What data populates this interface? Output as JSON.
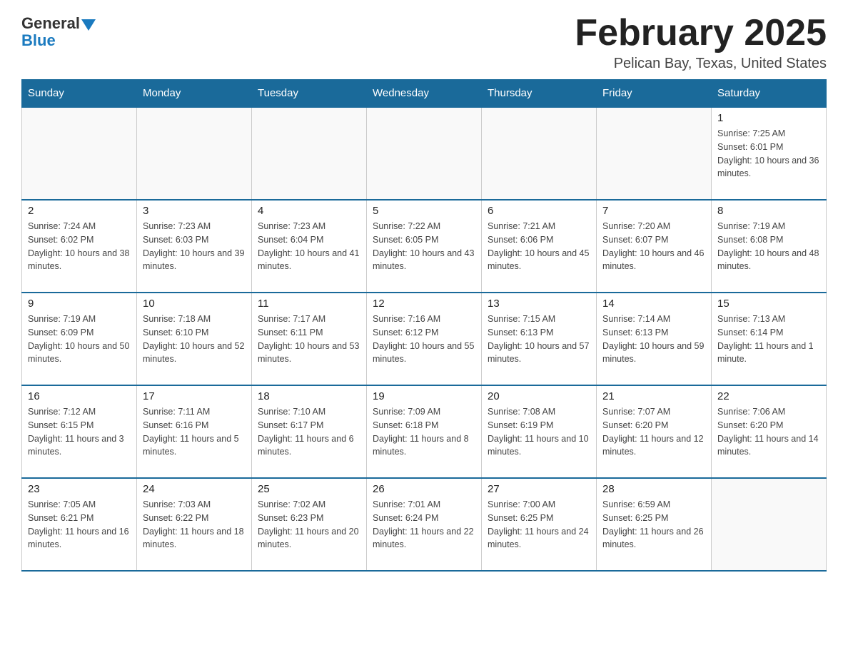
{
  "header": {
    "logo_general": "General",
    "logo_blue": "Blue",
    "month_title": "February 2025",
    "location": "Pelican Bay, Texas, United States"
  },
  "days_of_week": [
    "Sunday",
    "Monday",
    "Tuesday",
    "Wednesday",
    "Thursday",
    "Friday",
    "Saturday"
  ],
  "weeks": [
    {
      "days": [
        {
          "number": "",
          "sunrise": "",
          "sunset": "",
          "daylight": ""
        },
        {
          "number": "",
          "sunrise": "",
          "sunset": "",
          "daylight": ""
        },
        {
          "number": "",
          "sunrise": "",
          "sunset": "",
          "daylight": ""
        },
        {
          "number": "",
          "sunrise": "",
          "sunset": "",
          "daylight": ""
        },
        {
          "number": "",
          "sunrise": "",
          "sunset": "",
          "daylight": ""
        },
        {
          "number": "",
          "sunrise": "",
          "sunset": "",
          "daylight": ""
        },
        {
          "number": "1",
          "sunrise": "Sunrise: 7:25 AM",
          "sunset": "Sunset: 6:01 PM",
          "daylight": "Daylight: 10 hours and 36 minutes."
        }
      ]
    },
    {
      "days": [
        {
          "number": "2",
          "sunrise": "Sunrise: 7:24 AM",
          "sunset": "Sunset: 6:02 PM",
          "daylight": "Daylight: 10 hours and 38 minutes."
        },
        {
          "number": "3",
          "sunrise": "Sunrise: 7:23 AM",
          "sunset": "Sunset: 6:03 PM",
          "daylight": "Daylight: 10 hours and 39 minutes."
        },
        {
          "number": "4",
          "sunrise": "Sunrise: 7:23 AM",
          "sunset": "Sunset: 6:04 PM",
          "daylight": "Daylight: 10 hours and 41 minutes."
        },
        {
          "number": "5",
          "sunrise": "Sunrise: 7:22 AM",
          "sunset": "Sunset: 6:05 PM",
          "daylight": "Daylight: 10 hours and 43 minutes."
        },
        {
          "number": "6",
          "sunrise": "Sunrise: 7:21 AM",
          "sunset": "Sunset: 6:06 PM",
          "daylight": "Daylight: 10 hours and 45 minutes."
        },
        {
          "number": "7",
          "sunrise": "Sunrise: 7:20 AM",
          "sunset": "Sunset: 6:07 PM",
          "daylight": "Daylight: 10 hours and 46 minutes."
        },
        {
          "number": "8",
          "sunrise": "Sunrise: 7:19 AM",
          "sunset": "Sunset: 6:08 PM",
          "daylight": "Daylight: 10 hours and 48 minutes."
        }
      ]
    },
    {
      "days": [
        {
          "number": "9",
          "sunrise": "Sunrise: 7:19 AM",
          "sunset": "Sunset: 6:09 PM",
          "daylight": "Daylight: 10 hours and 50 minutes."
        },
        {
          "number": "10",
          "sunrise": "Sunrise: 7:18 AM",
          "sunset": "Sunset: 6:10 PM",
          "daylight": "Daylight: 10 hours and 52 minutes."
        },
        {
          "number": "11",
          "sunrise": "Sunrise: 7:17 AM",
          "sunset": "Sunset: 6:11 PM",
          "daylight": "Daylight: 10 hours and 53 minutes."
        },
        {
          "number": "12",
          "sunrise": "Sunrise: 7:16 AM",
          "sunset": "Sunset: 6:12 PM",
          "daylight": "Daylight: 10 hours and 55 minutes."
        },
        {
          "number": "13",
          "sunrise": "Sunrise: 7:15 AM",
          "sunset": "Sunset: 6:13 PM",
          "daylight": "Daylight: 10 hours and 57 minutes."
        },
        {
          "number": "14",
          "sunrise": "Sunrise: 7:14 AM",
          "sunset": "Sunset: 6:13 PM",
          "daylight": "Daylight: 10 hours and 59 minutes."
        },
        {
          "number": "15",
          "sunrise": "Sunrise: 7:13 AM",
          "sunset": "Sunset: 6:14 PM",
          "daylight": "Daylight: 11 hours and 1 minute."
        }
      ]
    },
    {
      "days": [
        {
          "number": "16",
          "sunrise": "Sunrise: 7:12 AM",
          "sunset": "Sunset: 6:15 PM",
          "daylight": "Daylight: 11 hours and 3 minutes."
        },
        {
          "number": "17",
          "sunrise": "Sunrise: 7:11 AM",
          "sunset": "Sunset: 6:16 PM",
          "daylight": "Daylight: 11 hours and 5 minutes."
        },
        {
          "number": "18",
          "sunrise": "Sunrise: 7:10 AM",
          "sunset": "Sunset: 6:17 PM",
          "daylight": "Daylight: 11 hours and 6 minutes."
        },
        {
          "number": "19",
          "sunrise": "Sunrise: 7:09 AM",
          "sunset": "Sunset: 6:18 PM",
          "daylight": "Daylight: 11 hours and 8 minutes."
        },
        {
          "number": "20",
          "sunrise": "Sunrise: 7:08 AM",
          "sunset": "Sunset: 6:19 PM",
          "daylight": "Daylight: 11 hours and 10 minutes."
        },
        {
          "number": "21",
          "sunrise": "Sunrise: 7:07 AM",
          "sunset": "Sunset: 6:20 PM",
          "daylight": "Daylight: 11 hours and 12 minutes."
        },
        {
          "number": "22",
          "sunrise": "Sunrise: 7:06 AM",
          "sunset": "Sunset: 6:20 PM",
          "daylight": "Daylight: 11 hours and 14 minutes."
        }
      ]
    },
    {
      "days": [
        {
          "number": "23",
          "sunrise": "Sunrise: 7:05 AM",
          "sunset": "Sunset: 6:21 PM",
          "daylight": "Daylight: 11 hours and 16 minutes."
        },
        {
          "number": "24",
          "sunrise": "Sunrise: 7:03 AM",
          "sunset": "Sunset: 6:22 PM",
          "daylight": "Daylight: 11 hours and 18 minutes."
        },
        {
          "number": "25",
          "sunrise": "Sunrise: 7:02 AM",
          "sunset": "Sunset: 6:23 PM",
          "daylight": "Daylight: 11 hours and 20 minutes."
        },
        {
          "number": "26",
          "sunrise": "Sunrise: 7:01 AM",
          "sunset": "Sunset: 6:24 PM",
          "daylight": "Daylight: 11 hours and 22 minutes."
        },
        {
          "number": "27",
          "sunrise": "Sunrise: 7:00 AM",
          "sunset": "Sunset: 6:25 PM",
          "daylight": "Daylight: 11 hours and 24 minutes."
        },
        {
          "number": "28",
          "sunrise": "Sunrise: 6:59 AM",
          "sunset": "Sunset: 6:25 PM",
          "daylight": "Daylight: 11 hours and 26 minutes."
        },
        {
          "number": "",
          "sunrise": "",
          "sunset": "",
          "daylight": ""
        }
      ]
    }
  ]
}
